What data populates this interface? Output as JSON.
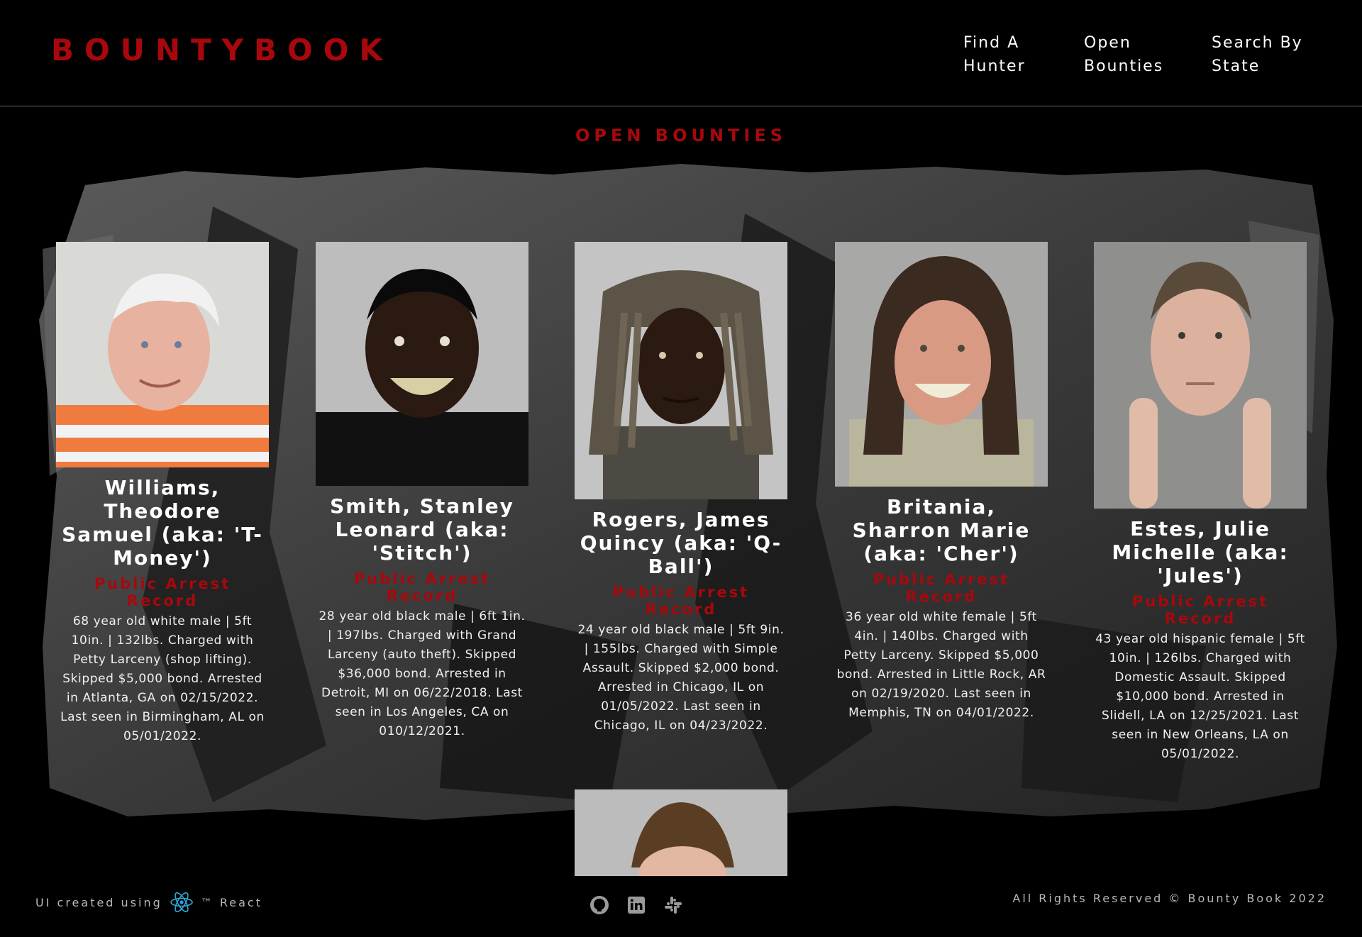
{
  "header": {
    "logo": "BOUNTYBOOK",
    "nav": [
      {
        "line1": "Find A",
        "line2": "Hunter"
      },
      {
        "line1": "Open",
        "line2": "Bounties"
      },
      {
        "line1": "Search By",
        "line2": "State"
      }
    ]
  },
  "main": {
    "title": "OPEN BOUNTIES",
    "record_label": "Public Arrest Record",
    "cards": [
      {
        "name": "Williams, Theodore Samuel (aka: 'T-Money')",
        "description": "68 year old white male | 5ft 10in. | 132lbs. Charged with Petty Larceny (shop lifting). Skipped $5,000 bond. Arrested in Atlanta, GA on 02/15/2022. Last seen in Birmingham, AL on 05/01/2022."
      },
      {
        "name": "Smith, Stanley Leonard (aka: 'Stitch')",
        "description": "28 year old black male | 6ft 1in. | 197lbs. Charged with Grand Larceny (auto theft). Skipped $36,000 bond. Arrested in Detroit, MI on 06/22/2018. Last seen in Los Angeles, CA on 010/12/2021."
      },
      {
        "name": "Rogers, James Quincy (aka: 'Q-Ball')",
        "description": "24 year old black male | 5ft 9in. | 155lbs. Charged with Simple Assault. Skipped $2,000 bond. Arrested in Chicago, IL on 01/05/2022. Last seen in Chicago, IL on 04/23/2022."
      },
      {
        "name": "Britania, Sharron Marie (aka: 'Cher')",
        "description": "36 year old white female | 5ft 4in. | 140lbs. Charged with Petty Larceny. Skipped $5,000 bond. Arrested in Little Rock, AR on 02/19/2020. Last seen in Memphis, TN on 04/01/2022."
      },
      {
        "name": "Estes, Julie Michelle (aka: 'Jules')",
        "description": "43 year old hispanic female | 5ft 10in. | 126lbs. Charged with Domestic Assault. Skipped $10,000 bond. Arrested in Slidell, LA on 12/25/2021. Last seen in New Orleans, LA on 05/01/2022."
      }
    ]
  },
  "footer": {
    "credit_prefix": "UI created using",
    "credit_suffix": "™ React",
    "socials": [
      "github-icon",
      "linkedin-icon",
      "slack-icon"
    ],
    "copyright": "All Rights Reserved © Bounty Book 2022"
  },
  "colors": {
    "accent": "#a8080c",
    "background": "#000000",
    "text": "#ffffff"
  }
}
